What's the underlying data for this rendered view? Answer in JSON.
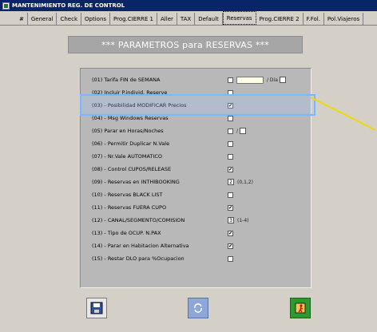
{
  "window": {
    "title": "MANTENIMIENTO REG. DE CONTROL"
  },
  "tabs": [
    {
      "label": "#"
    },
    {
      "label": "General"
    },
    {
      "label": "Check"
    },
    {
      "label": "Options"
    },
    {
      "label": "Prog.CIERRE 1"
    },
    {
      "label": "Aller"
    },
    {
      "label": "TAX"
    },
    {
      "label": "Default"
    },
    {
      "label": "Reservas"
    },
    {
      "label": "Prog.CIERRE 2"
    },
    {
      "label": "F.Fol."
    },
    {
      "label": "Pol.Viajeros"
    }
  ],
  "header": {
    "title": "*** PARAMETROS para RESERVAS ***"
  },
  "rows": [
    {
      "label": "(01)  Tarifa FIN de SEMANA",
      "value": "",
      "extra": "/ Dia"
    },
    {
      "label": "(02)  Incluir P.individ. Reserve",
      "value": ""
    },
    {
      "label": "(03) - Posibilidad MODIFICAR Precios",
      "value": "✔"
    },
    {
      "label": "(04) - Msg Windows Reservas",
      "value": ""
    },
    {
      "label": "(05)  Parar en Horas/Noches",
      "value": "",
      "extra": "/"
    },
    {
      "label": "(06) - Permitir Duplicar N.Vale",
      "value": ""
    },
    {
      "label": "(07) - Nr.Vale AUTOMATICO",
      "value": ""
    },
    {
      "label": "(08) - Control CUPOS/RELEASE",
      "value": "✔"
    },
    {
      "label": "(09) - Reservas en INTHIBOOKING",
      "value": "2",
      "extra": "(0,1,2)"
    },
    {
      "label": "(10) - Reservas BLACK LIST",
      "value": ""
    },
    {
      "label": "(11) - Reservas FUERA CUPO",
      "value": "✔"
    },
    {
      "label": "(12) - CANAL/SEGMENTO/COMISION",
      "value": "3",
      "extra": "(1-4)"
    },
    {
      "label": "(13) - Tipo de OCUP.   N.PAX",
      "value": "✔"
    },
    {
      "label": "(14) - Parar en Habitacion Alternativa",
      "value": "✔"
    },
    {
      "label": "(15) - Restar DLO para %Ocupacion",
      "value": ""
    }
  ],
  "icons": {
    "save": "floppy-disk-icon",
    "refresh": "refresh-icon",
    "exit": "exit-door-icon"
  },
  "colors": {
    "accent": "#0a246a",
    "highlight": "#7cb7ff",
    "arrow": "#f0d800"
  }
}
